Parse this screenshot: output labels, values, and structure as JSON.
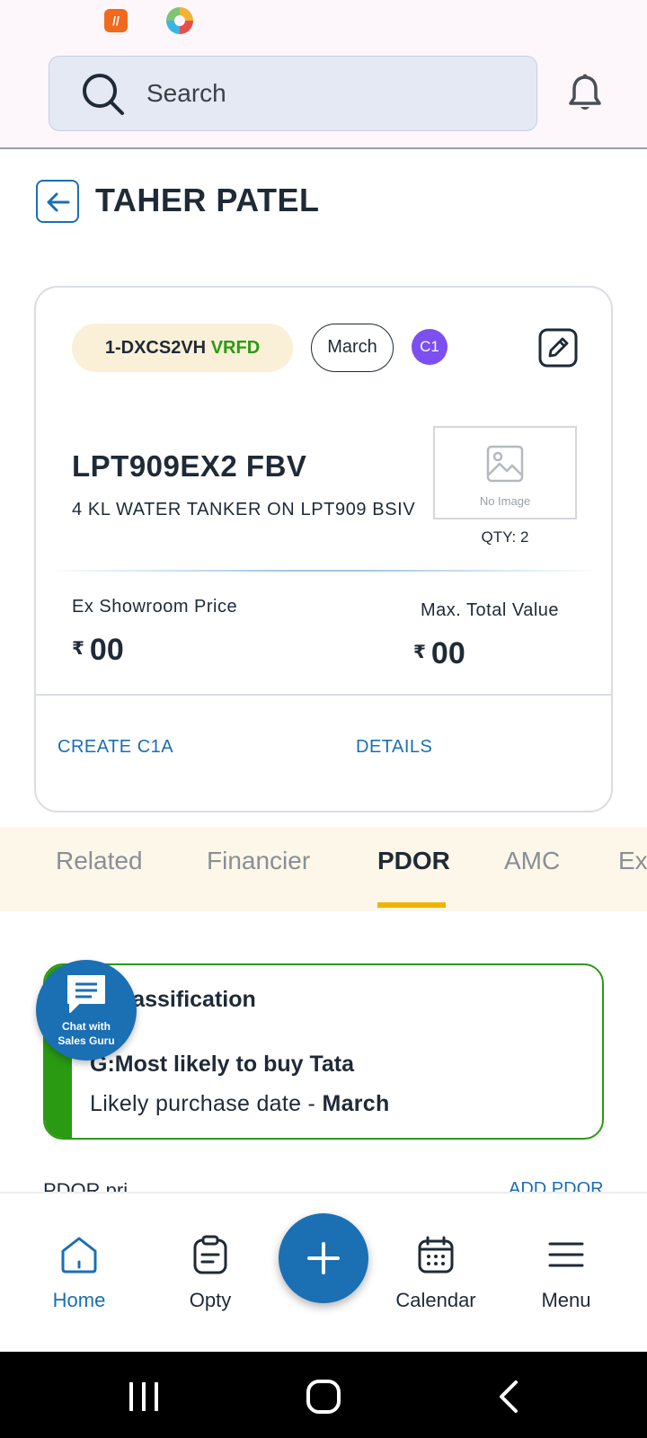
{
  "header": {
    "search_placeholder": "Search"
  },
  "page": {
    "title": "TAHER PATEL"
  },
  "card": {
    "opportunity_id": "1-DXCS2VH",
    "verified_label": "VRFD",
    "month_pill": "March",
    "category_badge": "C1",
    "model_name": "LPT909EX2 FBV",
    "model_description": "4 KL WATER TANKER ON LPT909 BSIV",
    "no_image_text": "No Image",
    "qty_label": "QTY: 2",
    "ex_showroom_label": "Ex Showroom Price",
    "ex_showroom_currency": "₹",
    "ex_showroom_value": "00",
    "max_total_label": "Max. Total Value",
    "max_total_currency": "₹",
    "max_total_value": "00",
    "create_c1a_label": "CREATE C1A",
    "details_label": "DETAILS"
  },
  "tabs": [
    {
      "label": "Related",
      "active": false
    },
    {
      "label": "Financier",
      "active": false
    },
    {
      "label": "PDOR",
      "active": true
    },
    {
      "label": "AMC",
      "active": false
    },
    {
      "label": "Ex",
      "active": false
    }
  ],
  "lead": {
    "title": "Lead Classification",
    "title_visible": "d Classification",
    "classification": "G:Most likely to buy Tata",
    "date_prefix": "Likely purchase date - ",
    "date_value": "March"
  },
  "chat_fab": {
    "line1": "Chat with",
    "line2": "Sales Guru"
  },
  "partial_section": {
    "left": "PDOR pri...",
    "right": "ADD PDOR"
  },
  "bottom_nav": [
    {
      "label": "Home",
      "icon": "home-icon",
      "active": true
    },
    {
      "label": "Opty",
      "icon": "clipboard-icon",
      "active": false
    },
    {
      "label": "Calendar",
      "icon": "calendar-icon",
      "active": false
    },
    {
      "label": "Menu",
      "icon": "menu-icon",
      "active": false
    }
  ],
  "colors": {
    "accent": "#1b6fb3",
    "verified": "#2a9a12",
    "tab_underline": "#f0b400",
    "badge": "#7b4ff0"
  }
}
